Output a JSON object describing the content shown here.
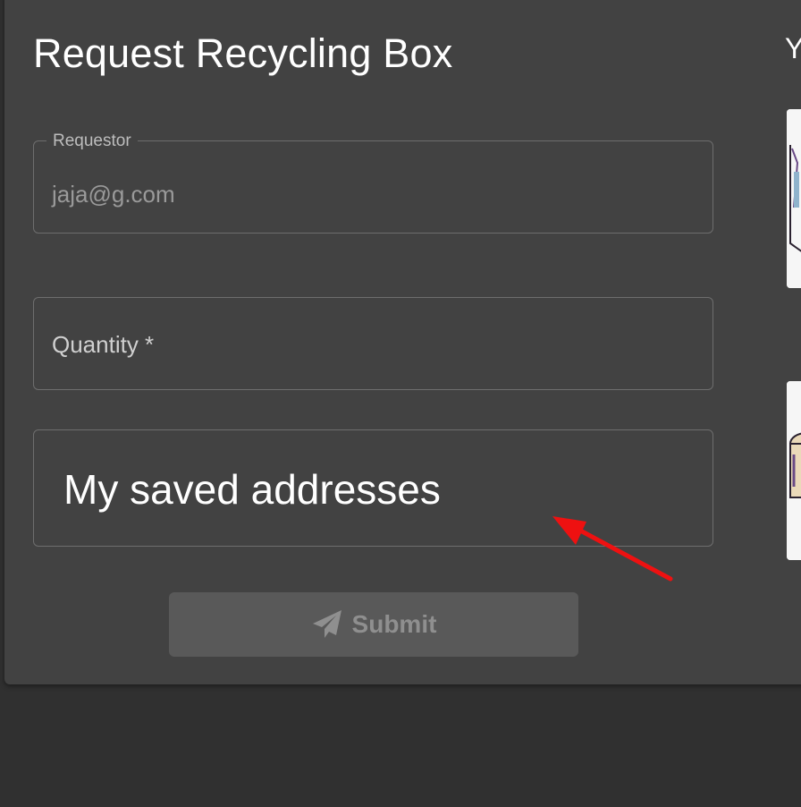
{
  "dialog": {
    "title": "Request Recycling Box",
    "right_heading_fragment": "Y"
  },
  "form": {
    "requestor": {
      "label": "Requestor",
      "value": "jaja@g.com"
    },
    "quantity": {
      "label": "Quantity *",
      "value": ""
    },
    "addresses": {
      "label": "My saved addresses"
    },
    "submit": {
      "label": "Submit",
      "icon": "paper-plane-icon",
      "disabled": true
    }
  },
  "annotation": {
    "type": "red-arrow",
    "color": "#ee1111"
  },
  "colors": {
    "page_background": "#303030",
    "card_background": "#424242",
    "border": "#6e6e6e",
    "disabled_button": "#595959"
  }
}
